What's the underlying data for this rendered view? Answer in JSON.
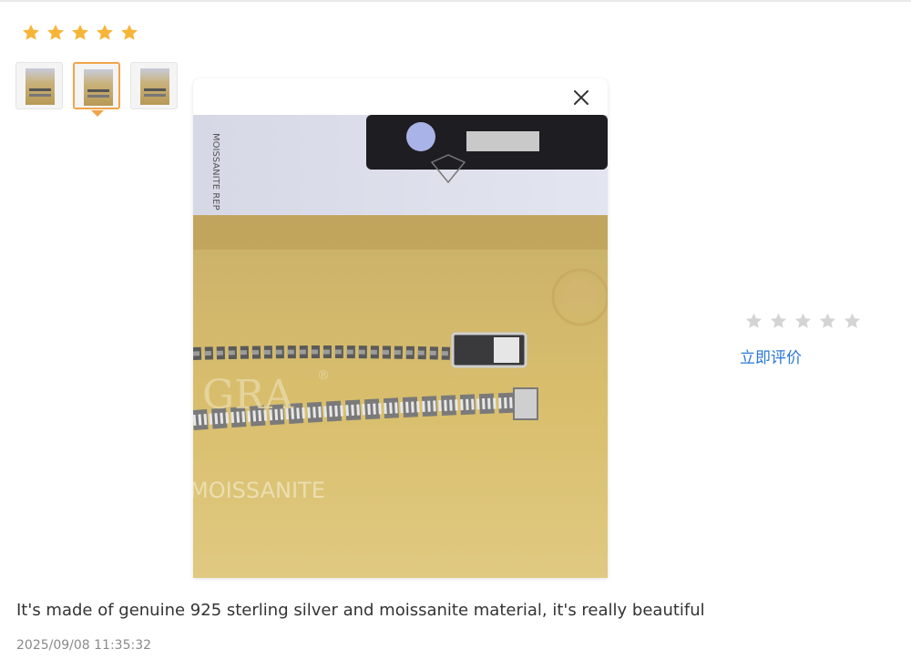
{
  "review": {
    "rating": 5,
    "text": "It's made of genuine 925 sterling silver and moissanite material, it's really beautiful",
    "date": "2025/09/08 11:35:32"
  },
  "thumbnails": {
    "count": 3,
    "selected_index": 1
  },
  "popup": {
    "close_icon": "close-icon",
    "photo_text": {
      "card_side_text": "MOISSANITE REP",
      "brand": "GRA",
      "brand_mark": "®",
      "brand_subtitle": "MOISSANITE"
    }
  },
  "rate_panel": {
    "stars_filled": 0,
    "stars_total": 5,
    "link_label": "立即评价"
  },
  "colors": {
    "star_filled": "#f7b538",
    "star_empty": "#d4d4d4",
    "thumb_active_border": "#f0a44a",
    "link": "#2a78d6"
  }
}
